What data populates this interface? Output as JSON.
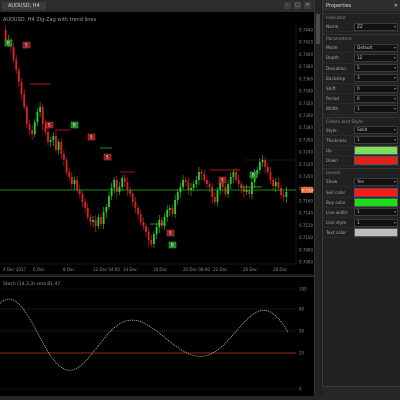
{
  "window": {
    "tab_title": "AUDUSD, H4"
  },
  "chart": {
    "info_text": "AUDUSD, H4 Zig-Zag with trend lines",
    "price_axis": [
      "0.7440",
      "0.7420",
      "0.7400",
      "0.7380",
      "0.7360",
      "0.7340",
      "0.7320",
      "0.7300",
      "0.7280",
      "0.7260",
      "0.7240",
      "0.7220",
      "0.7200",
      "0.7180",
      "0.7160",
      "0.7140",
      "0.7120",
      "0.7100",
      "0.7080",
      "0.7060"
    ],
    "current_price": "0.7199",
    "time_axis": [
      "4 Dec 2017",
      "6 Dec",
      "8 Dec",
      "12 Dec 04:00",
      "14 Dec",
      "18 Dec",
      "20 Dec 08:00",
      "22 Dec",
      "26 Dec",
      "28 Dec"
    ],
    "buy_marker": "B",
    "sell_marker": "S"
  },
  "oscillator": {
    "title": "Stoch (14,3,3) sma 81.47",
    "levels": [
      "100",
      "80",
      "50",
      "20",
      "0"
    ]
  },
  "panel": {
    "title": "Properties",
    "sections": [
      {
        "name": "Indicator",
        "rows": [
          {
            "label": "Name",
            "value": "ZZ"
          }
        ]
      },
      {
        "name": "Parameters",
        "rows": [
          {
            "label": "Mode",
            "value": "Default"
          },
          {
            "label": "Depth",
            "value": "12"
          },
          {
            "label": "Deviation",
            "value": "5"
          },
          {
            "label": "Backstep",
            "value": "3"
          },
          {
            "label": "Shift",
            "value": "0"
          },
          {
            "label": "Period",
            "value": "0"
          },
          {
            "label": "Width",
            "value": "1"
          }
        ]
      },
      {
        "name": "Colors and Style",
        "rows": [
          {
            "label": "Style",
            "value": "Solid"
          },
          {
            "label": "Thickness",
            "value": "1"
          },
          {
            "label": "Up",
            "color": "#7CE05C"
          },
          {
            "label": "Down",
            "color": "#E5201A"
          }
        ]
      },
      {
        "name": "Levels",
        "rows": [
          {
            "label": "Show",
            "value": "Yes"
          },
          {
            "label": "Sell color",
            "color": "#FF1A1A"
          },
          {
            "label": "Buy color",
            "color": "#1AE01A"
          },
          {
            "label": "Line width",
            "value": "1"
          },
          {
            "label": "Line style",
            "value": "1"
          },
          {
            "label": "Text color",
            "color": "#BEBEBE"
          }
        ]
      }
    ]
  },
  "colors": {
    "bull": "#2bd12b",
    "bear": "#e02222",
    "ma": "#26b826",
    "signal_green": "#1f7d1f",
    "signal_red": "#8a1a1a",
    "dotted": "#cfcfaf"
  }
}
